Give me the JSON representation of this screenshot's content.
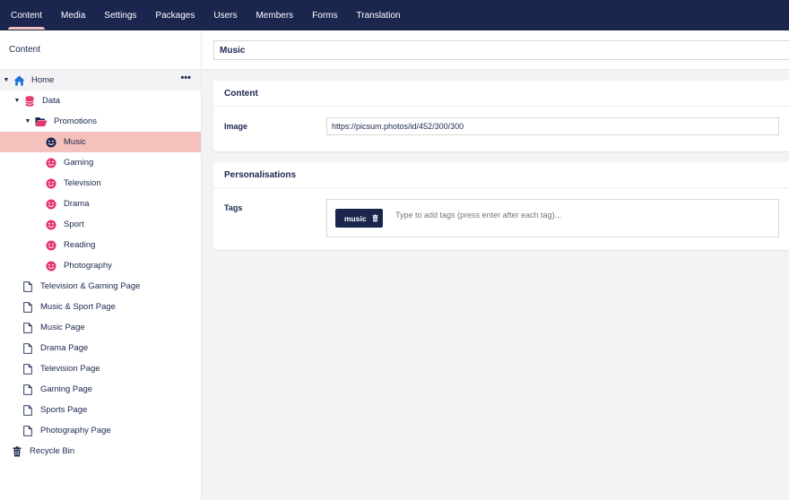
{
  "nav": [
    {
      "label": "Content",
      "active": true
    },
    {
      "label": "Media"
    },
    {
      "label": "Settings"
    },
    {
      "label": "Packages"
    },
    {
      "label": "Users"
    },
    {
      "label": "Members"
    },
    {
      "label": "Forms"
    },
    {
      "label": "Translation"
    }
  ],
  "sidebar": {
    "title": "Content",
    "tree": {
      "home": {
        "label": "Home",
        "icon": "home-icon",
        "menu": "•••"
      },
      "data": {
        "label": "Data",
        "icon": "database-icon"
      },
      "promotions": {
        "label": "Promotions",
        "icon": "folder-open-icon"
      },
      "items": [
        {
          "label": "Music",
          "icon": "smiley-icon",
          "selected": true
        },
        {
          "label": "Gaming",
          "icon": "smiley-icon"
        },
        {
          "label": "Television",
          "icon": "smiley-icon"
        },
        {
          "label": "Drama",
          "icon": "smiley-icon"
        },
        {
          "label": "Sport",
          "icon": "smiley-icon"
        },
        {
          "label": "Reading",
          "icon": "smiley-icon"
        },
        {
          "label": "Photography",
          "icon": "smiley-icon"
        }
      ],
      "pages": [
        {
          "label": "Television & Gaming Page",
          "icon": "document-icon"
        },
        {
          "label": "Music & Sport Page",
          "icon": "document-icon"
        },
        {
          "label": "Music Page",
          "icon": "document-icon"
        },
        {
          "label": "Drama Page",
          "icon": "document-icon"
        },
        {
          "label": "Television Page",
          "icon": "document-icon"
        },
        {
          "label": "Gaming Page",
          "icon": "document-icon"
        },
        {
          "label": "Sports Page",
          "icon": "document-icon"
        },
        {
          "label": "Photography Page",
          "icon": "document-icon"
        }
      ],
      "recycle": {
        "label": "Recycle Bin",
        "icon": "trash-icon"
      }
    }
  },
  "editor": {
    "name_value": "Music",
    "content_group": {
      "title": "Content",
      "image_label": "Image",
      "image_value": "https://picsum.photos/id/452/300/300"
    },
    "personal_group": {
      "title": "Personalisations",
      "tags_label": "Tags",
      "tags": [
        {
          "label": "music"
        }
      ],
      "tags_placeholder": "Type to add tags (press enter after each tag)..."
    }
  },
  "colors": {
    "nav_bg": "#1b264f",
    "accent": "#f5c1bc",
    "icon_pink": "#e7336f",
    "text": "#1b264f"
  }
}
